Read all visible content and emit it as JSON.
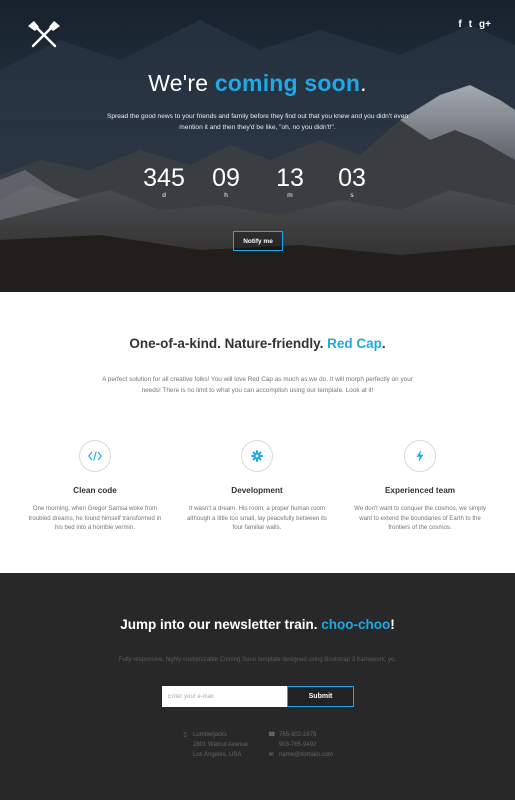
{
  "hero": {
    "social": [
      "f",
      "t",
      "g+"
    ],
    "title_part1": "We're ",
    "title_accent": "coming soon",
    "title_end": ".",
    "subtitle": "Spread the good news to your friends and family before they find out that you knew and you didn't even mention it and then they'd be like, \"oh, no you didn't!\".",
    "countdown": [
      {
        "value": "345",
        "label": "d"
      },
      {
        "value": "09",
        "label": "h"
      },
      {
        "value": "13",
        "label": "m"
      },
      {
        "value": "03",
        "label": "s"
      }
    ],
    "notify_label": "Notify me"
  },
  "features": {
    "title_part1": "One-of-a-kind. Nature-friendly. ",
    "title_accent": "Red Cap",
    "title_end": ".",
    "subtitle": "A perfect solution for all creative folks! You will love Red Cap as much as we do. It will morph perfectly on your needs! There is no limit to what you can accomplish using our template. Look at it!",
    "items": [
      {
        "icon": "code-icon",
        "title": "Clean code",
        "text": "One morning, when Gregor Samsa woke from troubled dreams, he found himself transformed in his bed into a horrible vermin."
      },
      {
        "icon": "gear-icon",
        "title": "Development",
        "text": "It wasn't a dream. His room, a proper human room although a little too small, lay peacefully between its four familiar walls."
      },
      {
        "icon": "bolt-icon",
        "title": "Experienced team",
        "text": "We don't want to conquer the cosmos, we simply want to extend the boundaries of Earth to the frontiers of the cosmos."
      }
    ]
  },
  "newsletter": {
    "title_part1": "Jump into our newsletter train. ",
    "title_accent": "choo-choo",
    "title_end": "!",
    "subtitle": "Fully responsive, highly customizable Coming Soon template designed using Bootstrap 3 framework, yo.",
    "input_placeholder": "Enter your e-mail",
    "submit_label": "Submit",
    "address": [
      "Lumberjacks",
      "2801 Walnut Avenue",
      "Los Angeles, USA"
    ],
    "phones": [
      "765-302-2878",
      "903-765-9492"
    ],
    "email": "name@domain.com"
  },
  "colors": {
    "accent": "#1fa8e6",
    "dark_bg": "#282828"
  }
}
